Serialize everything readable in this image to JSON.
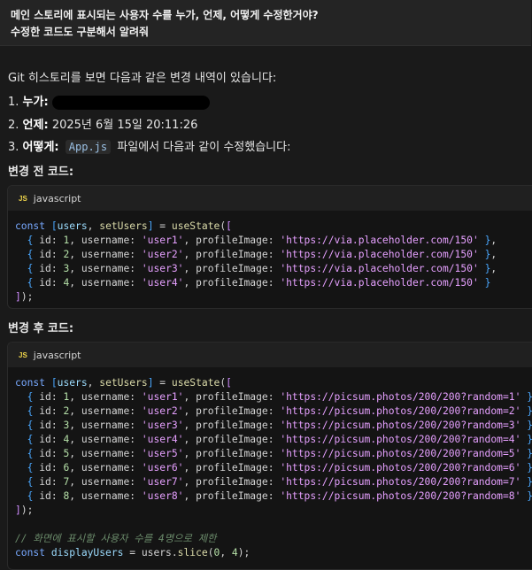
{
  "question": {
    "line1": "메인 스토리에 표시되는 사용자 수를 누가, 언제, 어떻게 수정한거야?",
    "line2": "수정한 코드도 구분해서 알려줘"
  },
  "answer": {
    "intro": "Git 히스토리를 보면 다음과 같은 변경 내역이 있습니다:",
    "who_label": "누가:",
    "when_label": "언제:",
    "when_value": "2025년 6월 15일 20:11:26",
    "how_label": "어떻게:",
    "how_file": "App.js",
    "how_text": "파일에서 다음과 같이 수정했습니다:",
    "before_heading": "변경 전 코드:",
    "after_heading": "변경 후 코드:"
  },
  "code_before": {
    "lang": "javascript",
    "users": [
      {
        "id": "1",
        "username": "'user1'",
        "image": "'https://via.placeholder.com/150'"
      },
      {
        "id": "2",
        "username": "'user2'",
        "image": "'https://via.placeholder.com/150'"
      },
      {
        "id": "3",
        "username": "'user3'",
        "image": "'https://via.placeholder.com/150'"
      },
      {
        "id": "4",
        "username": "'user4'",
        "image": "'https://via.placeholder.com/150'"
      }
    ]
  },
  "code_after": {
    "lang": "javascript",
    "users": [
      {
        "id": "1",
        "username": "'user1'",
        "image": "'https://picsum.photos/200/200?random=1'"
      },
      {
        "id": "2",
        "username": "'user2'",
        "image": "'https://picsum.photos/200/200?random=2'"
      },
      {
        "id": "3",
        "username": "'user3'",
        "image": "'https://picsum.photos/200/200?random=3'"
      },
      {
        "id": "4",
        "username": "'user4'",
        "image": "'https://picsum.photos/200/200?random=4'"
      },
      {
        "id": "5",
        "username": "'user5'",
        "image": "'https://picsum.photos/200/200?random=5'"
      },
      {
        "id": "6",
        "username": "'user6'",
        "image": "'https://picsum.photos/200/200?random=6'"
      },
      {
        "id": "7",
        "username": "'user7'",
        "image": "'https://picsum.photos/200/200?random=7'"
      },
      {
        "id": "8",
        "username": "'user8'",
        "image": "'https://picsum.photos/200/200?random=8'"
      }
    ],
    "comment": "// 화면에 표시할 사용자 수를 4명으로 제한",
    "slice_start": "0",
    "slice_end": "4"
  },
  "js_icon_label": "JS",
  "colors": {
    "background": "#1a1a1a",
    "code_bg": "#141414",
    "string": "#e6a0ff",
    "keyword": "#78a9ff",
    "comment": "#6a8a6a"
  }
}
